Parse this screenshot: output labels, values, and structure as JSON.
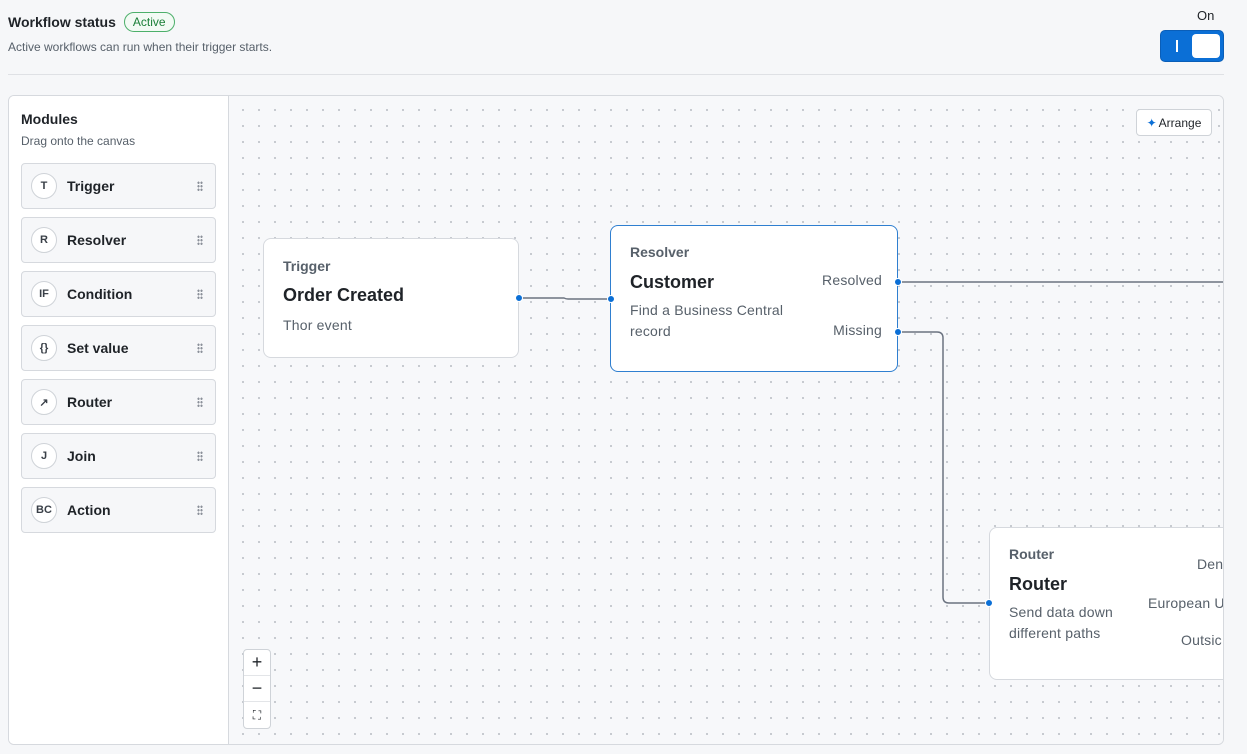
{
  "header": {
    "title": "Workflow status",
    "badge": "Active",
    "subtitle": "Active workflows can run when their trigger starts.",
    "toggle_label": "On",
    "toggle_state": "on"
  },
  "sidebar": {
    "title": "Modules",
    "subtitle": "Drag onto the canvas",
    "modules": [
      {
        "icon": "T",
        "label": "Trigger"
      },
      {
        "icon": "R",
        "label": "Resolver"
      },
      {
        "icon": "IF",
        "label": "Condition"
      },
      {
        "icon": "{}",
        "label": "Set value"
      },
      {
        "icon": "↗",
        "label": "Router"
      },
      {
        "icon": "J",
        "label": "Join"
      },
      {
        "icon": "BC",
        "label": "Action"
      }
    ]
  },
  "canvas": {
    "arrange_icon": "✦",
    "arrange_label": "Arrange",
    "zoom": {
      "in": "+",
      "out": "−",
      "fit": "⛶"
    },
    "nodes": {
      "trigger": {
        "kind": "Trigger",
        "name": "Order Created",
        "desc": "Thor event"
      },
      "resolver": {
        "kind": "Resolver",
        "name": "Customer",
        "desc": "Find a Business Central record",
        "outputs": [
          "Resolved",
          "Missing"
        ]
      },
      "router": {
        "kind": "Router",
        "name": "Router",
        "desc": "Send data down different paths",
        "outputs": [
          "Den",
          "European U",
          "Outsic"
        ]
      }
    },
    "colors": {
      "accent": "#0b6fd6",
      "edge": "#6b7380"
    }
  }
}
